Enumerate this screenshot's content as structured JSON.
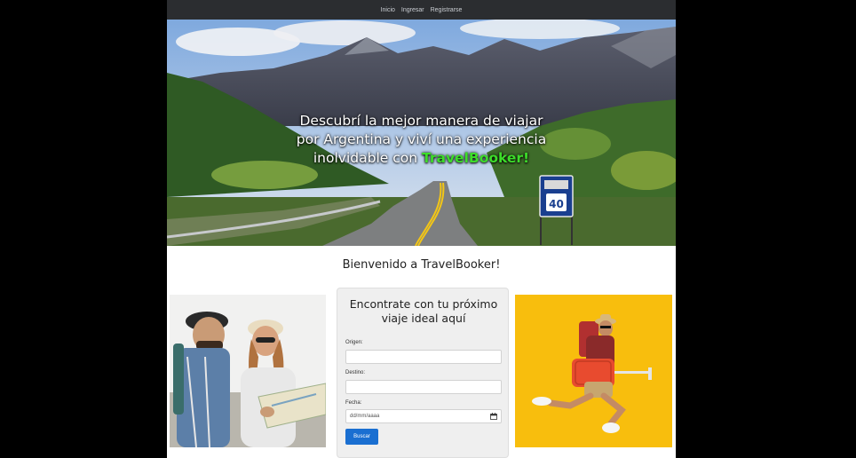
{
  "navbar": {
    "items": [
      "Inicio",
      "Ingresar",
      "Registrarse"
    ]
  },
  "hero": {
    "line1": "Descubrí la mejor manera de viajar",
    "line2": "por Argentina y viví una experiencia",
    "line3_prefix": "inolvidable con ",
    "brand": "TravelBooker!",
    "route_sign_number": "40",
    "brand_color": "#3ddc2a"
  },
  "welcome": {
    "text": "Bienvenido a TravelBooker!"
  },
  "search": {
    "title_line1": "Encontrate con tu próximo",
    "title_line2": "viaje ideal aquí",
    "origin_label": "Origen:",
    "origin_value": "",
    "destination_label": "Destino:",
    "destination_value": "",
    "date_label": "Fecha:",
    "date_placeholder": "dd/mm/aaaa",
    "button_label": "Buscar",
    "button_color": "#1a6fd1"
  },
  "images": {
    "left": "couple-with-map-photo",
    "right": "jumping-traveler-with-suitcase-photo",
    "right_background": "#f8be0d"
  }
}
